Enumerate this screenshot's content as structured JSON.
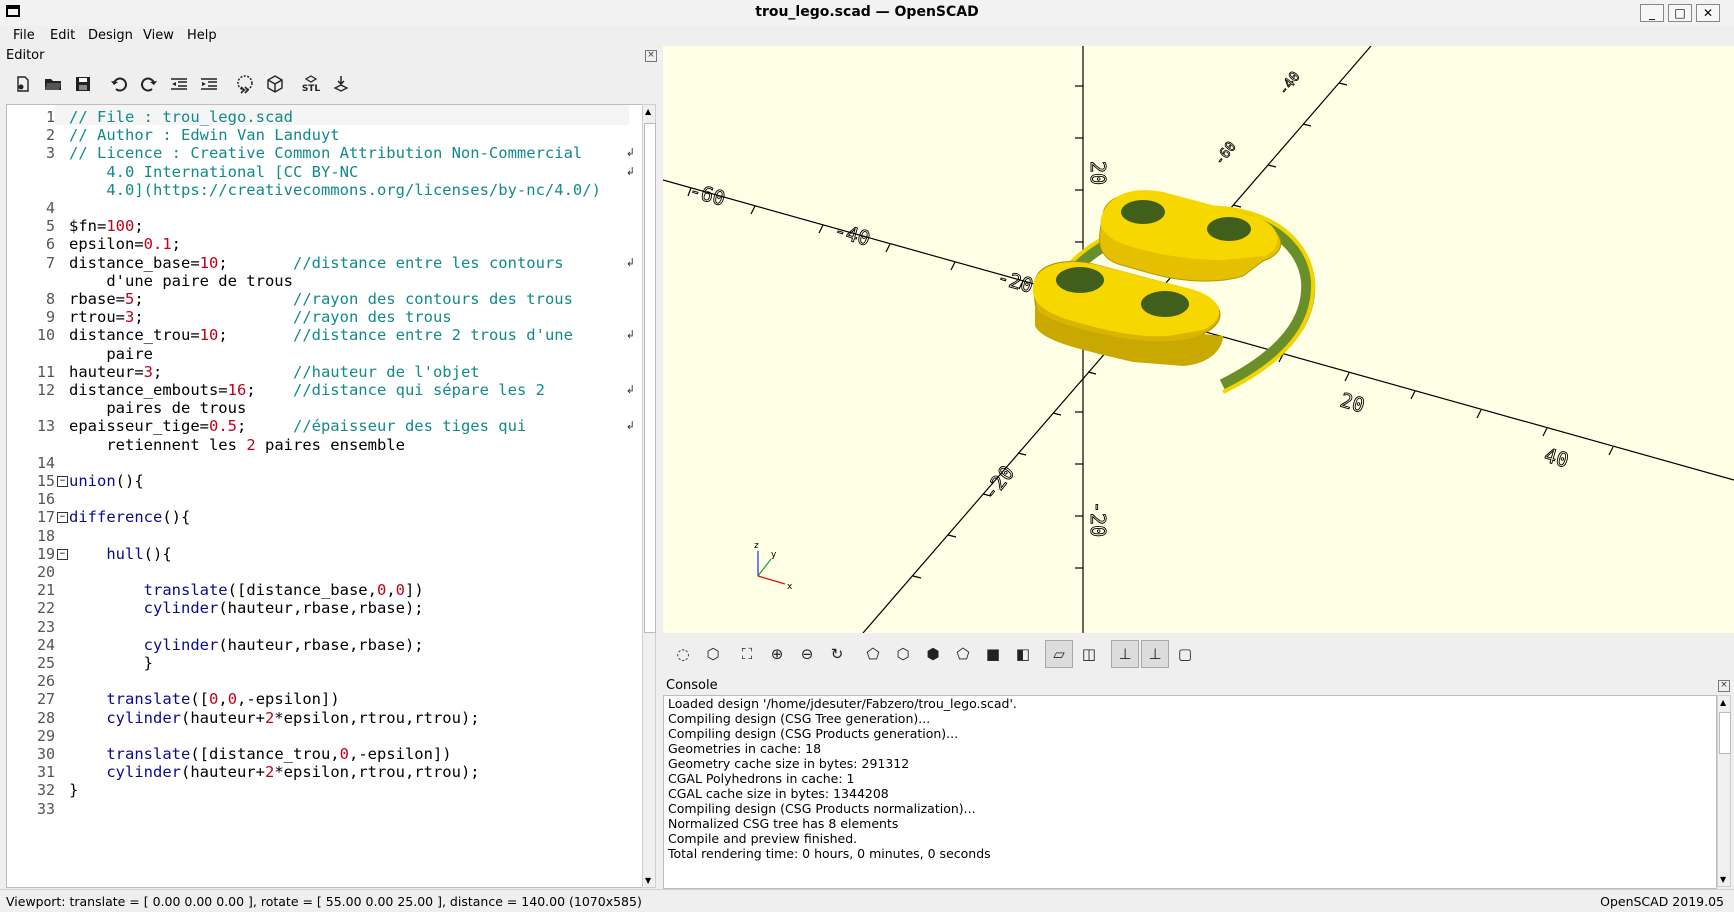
{
  "window": {
    "title": "trou_lego.scad — OpenSCAD",
    "min": "_",
    "max": "□",
    "close": "✕"
  },
  "menu": [
    "File",
    "Edit",
    "Design",
    "View",
    "Help"
  ],
  "editor": {
    "panel_title": "Editor",
    "toolbar_icons": [
      "new-file",
      "open-file",
      "save",
      "undo",
      "redo",
      "unindent",
      "indent",
      "preview",
      "render",
      "export-stl",
      "send-to-print"
    ],
    "stl_label": "STL",
    "line_numbers": [
      "1",
      "2",
      "3",
      "",
      "",
      "4",
      "5",
      "6",
      "7",
      "",
      "8",
      "9",
      "10",
      "",
      "11",
      "12",
      "",
      "13",
      "",
      "14",
      "15",
      "16",
      "17",
      "18",
      "19",
      "20",
      "21",
      "22",
      "23",
      "24",
      "25",
      "26",
      "27",
      "28",
      "29",
      "30",
      "31",
      "32",
      "33"
    ],
    "lines": [
      "// File : trou_lego.scad",
      "// Author : Edwin Van Landuyt",
      "// Licence : Creative Common Attribution Non-Commercial",
      "    4.0 International [CC BY-NC",
      "    4.0](https://creativecommons.org/licenses/by-nc/4.0/)",
      "",
      "$fn=100;",
      "epsilon=0.1;",
      "distance_base=10;       //distance entre les contours",
      "    d'une paire de trous",
      "rbase=5;                //rayon des contours des trous",
      "rtrou=3;                //rayon des trous",
      "distance_trou=10;       //distance entre 2 trous d'une",
      "    paire",
      "hauteur=3;              //hauteur de l'objet",
      "distance_embouts=16;    //distance qui sépare les 2",
      "    paires de trous",
      "epaisseur_tige=0.5;     //épaisseur des tiges qui",
      "    retiennent les 2 paires ensemble",
      "",
      "union(){",
      "",
      "difference(){",
      "",
      "    hull(){",
      "",
      "        translate([distance_base,0,0])",
      "        cylinder(hauteur,rbase,rbase);",
      "",
      "        cylinder(hauteur,rbase,rbase);",
      "        }",
      "",
      "    translate([0,0,-epsilon])",
      "    cylinder(hauteur+2*epsilon,rtrou,rtrou);",
      "",
      "    translate([distance_trou,0,-epsilon])",
      "    cylinder(hauteur+2*epsilon,rtrou,rtrou);",
      "}",
      ""
    ]
  },
  "viewport": {
    "axis_labels": [
      "-60",
      "-40",
      "-20",
      "20",
      "40",
      "20",
      "-20",
      "-20",
      "-40",
      "-60",
      "-20"
    ],
    "model_color": "#f5d300",
    "background": "#ffffe5",
    "gizmo": {
      "z": "z",
      "y": "y",
      "x": "x"
    }
  },
  "view_toolbar_icons": [
    "preview",
    "render",
    "view-all",
    "zoom-in",
    "zoom-out",
    "reset-view",
    "view-right",
    "view-top",
    "view-bottom",
    "view-left",
    "view-front",
    "view-back",
    "perspective",
    "orthogonal",
    "show-axes",
    "show-scale-markers",
    "show-edges"
  ],
  "console": {
    "title": "Console",
    "lines": [
      "Loaded design '/home/jdesuter/Fabzero/trou_lego.scad'.",
      "Compiling design (CSG Tree generation)...",
      "Compiling design (CSG Products generation)...",
      "Geometries in cache: 18",
      "Geometry cache size in bytes: 291312",
      "CGAL Polyhedrons in cache: 1",
      "CGAL cache size in bytes: 1344208",
      "Compiling design (CSG Products normalization)...",
      "Normalized CSG tree has 8 elements",
      "Compile and preview finished.",
      "Total rendering time: 0 hours, 0 minutes, 0 seconds"
    ]
  },
  "status": {
    "viewport": "Viewport: translate = [ 0.00 0.00 0.00 ], rotate = [ 55.00 0.00 25.00 ], distance = 140.00 (1070x585)",
    "version": "OpenSCAD 2019.05"
  }
}
